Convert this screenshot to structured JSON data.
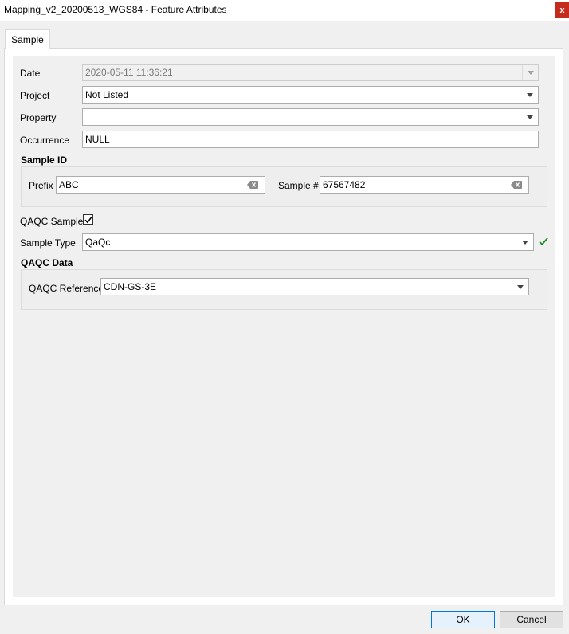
{
  "window": {
    "title": "Mapping_v2_20200513_WGS84 - Feature Attributes",
    "close_label": "x"
  },
  "tabs": [
    {
      "label": "Sample"
    }
  ],
  "form": {
    "date": {
      "label": "Date",
      "value": "2020-05-11 11:36:21"
    },
    "project": {
      "label": "Project",
      "value": "Not Listed"
    },
    "property": {
      "label": "Property",
      "value": ""
    },
    "occurrence": {
      "label": "Occurrence",
      "value": "NULL"
    },
    "sample_id": {
      "title": "Sample ID",
      "prefix_label": "Prefix",
      "prefix_value": "ABC",
      "sample_no_label": "Sample #",
      "sample_no_value": "67567482"
    },
    "qaqc_sample": {
      "label": "QAQC Sample?",
      "checked": true
    },
    "sample_type": {
      "label": "Sample Type",
      "value": "QaQc",
      "valid_color": "#1e8c1e"
    },
    "qaqc_data": {
      "title": "QAQC Data",
      "reference_label": "QAQC Reference",
      "reference_value": "CDN-GS-3E"
    }
  },
  "buttons": {
    "ok": "OK",
    "cancel": "Cancel"
  },
  "colors": {
    "close_button": "#c42b1c",
    "default_button_border": "#0078d7"
  },
  "icons": {
    "close": "close-icon",
    "dropdown": "chevron-down-icon",
    "clear": "clear-input-icon",
    "check": "checkmark-icon",
    "valid": "valid-check-icon"
  }
}
